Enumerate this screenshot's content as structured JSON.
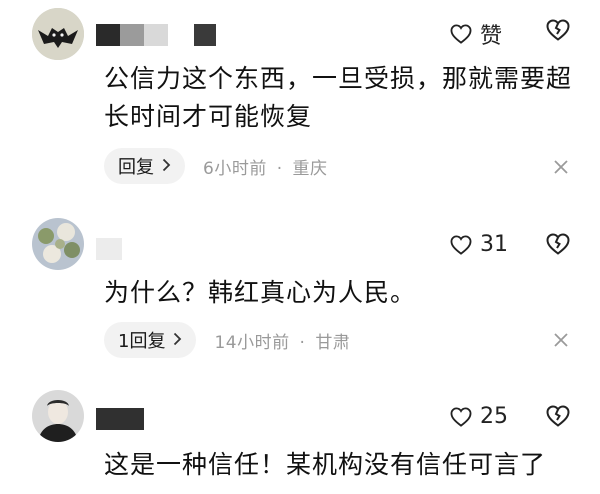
{
  "comments": [
    {
      "like_label": "赞",
      "text": "公信力这个东西，一旦受损，那就需要超长时间才可能恢复",
      "reply_label": "回复",
      "time": "6小时前",
      "sep": "·",
      "location": "重庆",
      "icons": {
        "like": "heart-outline-icon",
        "dislike": "broken-heart-icon",
        "close": "close-icon",
        "chevron": "chevron-right-icon"
      }
    },
    {
      "like_label": "31",
      "text": "为什么？韩红真心为人民。",
      "reply_label": "1回复",
      "time": "14小时前",
      "sep": "·",
      "location": "甘肃",
      "icons": {
        "like": "heart-outline-icon",
        "dislike": "broken-heart-icon",
        "close": "close-icon",
        "chevron": "chevron-right-icon"
      }
    },
    {
      "like_label": "25",
      "text": "这是一种信任！某机构没有信任可言了",
      "icons": {
        "like": "heart-outline-icon",
        "dislike": "broken-heart-icon"
      }
    }
  ],
  "colors": {
    "meta_gray": "#9a9a9a",
    "reply_bg": "#f2f2f2",
    "text": "#111111"
  }
}
